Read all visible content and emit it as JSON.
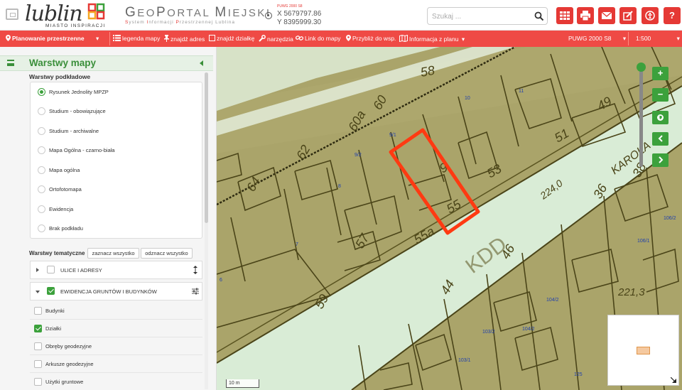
{
  "header": {
    "logo_text": "lublin",
    "logo_tagline": "MIASTO INSPIRACJI",
    "portal_title_parts": [
      "G",
      "EO",
      "P",
      "ORTAL ",
      "M",
      "IEJSKI"
    ],
    "portal_subtitle_parts": [
      "S",
      "ystem ",
      "I",
      "nformacji ",
      "P",
      "rzestrzennej ",
      "Lublina"
    ],
    "crs_label": "PUWG 2000 S8",
    "coord_x": "X 5679797.86",
    "coord_y": "Y 8395999.30",
    "search_placeholder": "Szukaj ...",
    "buttons": [
      "apps-grid-icon",
      "print-icon",
      "mail-icon",
      "edit-icon",
      "accessibility-icon",
      "help-icon"
    ],
    "help_label": "?"
  },
  "toolbar": {
    "mode_label": "Planowanie przestrzenne",
    "legend": "legenda mapy",
    "find_address": "znajdź adres",
    "find_parcel": "znajdź działkę",
    "tools": "narzędzia",
    "map_link": "Link do mapy",
    "zoom_to": "Przybliż do wsp.",
    "plan_info": "Informacja z planu",
    "crs": "PUWG 2000 S8",
    "scale": "1:500"
  },
  "sidebar": {
    "title": "Warstwy mapy",
    "base_layers_label": "Warstwy podkładowe",
    "base_layers": [
      {
        "label": "Rysunek Jednolity MPZP",
        "selected": true
      },
      {
        "label": "Studium - obowiązujące",
        "selected": false
      },
      {
        "label": "Studium - archiwalne",
        "selected": false
      },
      {
        "label": "Mapa Ogólna - czarno-biała",
        "selected": false
      },
      {
        "label": "Mapa ogólna",
        "selected": false
      },
      {
        "label": "Ortofotomapa",
        "selected": false
      },
      {
        "label": "Ewidencja",
        "selected": false
      },
      {
        "label": "Brak podkładu",
        "selected": false
      }
    ],
    "thematic_label": "Warstwy tematyczne",
    "select_all": "zaznacz wszystko",
    "deselect_all": "odznacz wszystko",
    "groups": [
      {
        "label": "ULICE I ADRESY",
        "checked": false,
        "expanded": false
      },
      {
        "label": "EWIDENCJA GRUNTÓW I BUDYNKÓW",
        "checked": true,
        "expanded": true
      }
    ],
    "ewidencja_layers": [
      {
        "label": "Budynki",
        "checked": false
      },
      {
        "label": "Działki",
        "checked": true
      },
      {
        "label": "Obręby geodezyjne",
        "checked": false
      },
      {
        "label": "Arkusze geodezyjne",
        "checked": false
      },
      {
        "label": "Użytki gruntowe",
        "checked": false
      }
    ]
  },
  "map": {
    "scale_label": "10 m",
    "zoom_in": "+",
    "zoom_out": "−",
    "parcel_numbers": [
      "10",
      "11",
      "9/1",
      "9/2",
      "8",
      "7",
      "6",
      "106/2",
      "106/1",
      "104/2",
      "104/2",
      "103/2",
      "103/1",
      "125"
    ],
    "handwritten_labels": [
      "58",
      "60",
      "60a",
      "62",
      "64",
      "49",
      "51",
      "53",
      "9",
      "55",
      "55a",
      "57",
      "59",
      "44",
      "46",
      "36",
      "38",
      "KDD",
      "KAROLA",
      "224,0",
      "221,3"
    ],
    "street_label": "KDD",
    "highlight_color": "#ff3a12",
    "controls": [
      "zoom-in",
      "zoom-out",
      "globe",
      "back",
      "forward"
    ]
  },
  "colors": {
    "accent_red": "#ef4a45",
    "accent_green": "#3ca13c",
    "map_base": "#a8a366",
    "road_fill": "#d9ecd6"
  }
}
